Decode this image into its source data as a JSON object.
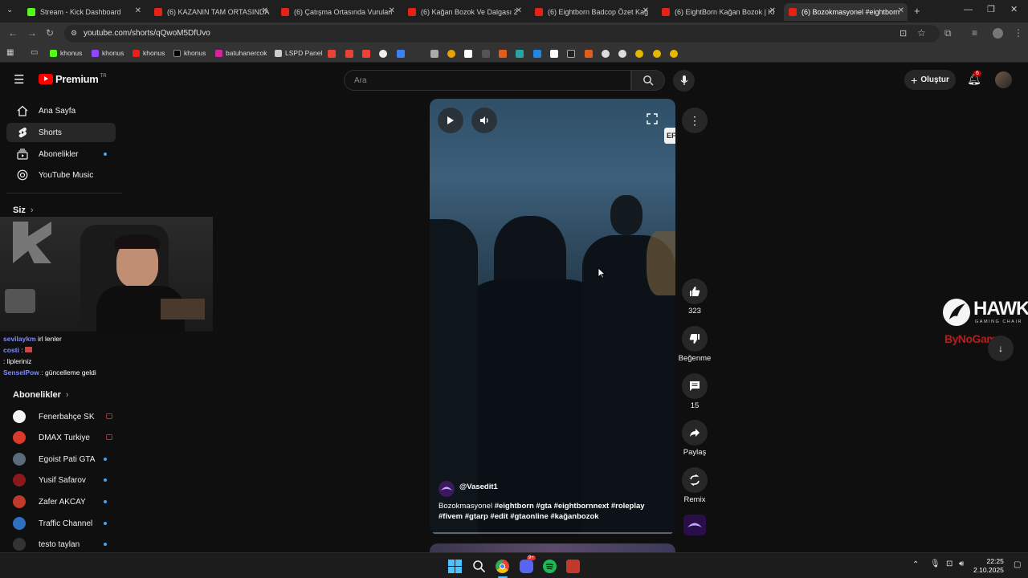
{
  "browser": {
    "tabs": [
      {
        "title": "Stream - Kick Dashboard",
        "icon": "kick"
      },
      {
        "title": "(6) KAZANIN TAM ORTASINDA",
        "icon": "youtube"
      },
      {
        "title": "(6) Çatışma Ortasında Vurulan",
        "icon": "youtube"
      },
      {
        "title": "(6) Kağan Bozok Ve Dalgası 2",
        "icon": "youtube"
      },
      {
        "title": "(6) Eightborn Badcop Özet Kağ",
        "icon": "youtube"
      },
      {
        "title": "(6) EightBorn Kağan Bozok | Ki",
        "icon": "youtube"
      },
      {
        "title": "(6) Bozokmasyonel #eightborn",
        "icon": "youtube",
        "active": true
      }
    ],
    "url": "youtube.com/shorts/qQwoM5DfUvo",
    "bookmarks": [
      "khonus",
      "khonus",
      "khonus",
      "khonus",
      "batuhanercok",
      "LSPD Panel"
    ]
  },
  "youtube": {
    "logo": "Premium",
    "logo_sup": "TR",
    "search_placeholder": "Ara",
    "create_label": "Oluştur",
    "notification_count": "6"
  },
  "sidebar": {
    "items": [
      {
        "label": "Ana Sayfa",
        "icon": "home-icon"
      },
      {
        "label": "Shorts",
        "icon": "shorts-icon",
        "active": true
      },
      {
        "label": "Abonelikler",
        "icon": "subscriptions-icon"
      },
      {
        "label": "YouTube Music",
        "icon": "music-icon"
      }
    ],
    "you_heading": "Siz",
    "subs_heading": "Abonelikler",
    "subscriptions": [
      {
        "name": "Fenerbahçe SK",
        "live": true,
        "color": "#f5f5f5"
      },
      {
        "name": "DMAX Turkiye",
        "live": true,
        "color": "#d93a2a"
      },
      {
        "name": "Egoist Pati GTA",
        "live": false,
        "color": "#5a6b7c"
      },
      {
        "name": "Yusif Safarov",
        "live": false,
        "color": "#8a1a1a"
      },
      {
        "name": "Zafer AKCAY",
        "live": false,
        "color": "#c0392b"
      },
      {
        "name": "Traffic Channel",
        "live": false,
        "color": "#2f6fbf"
      },
      {
        "name": "testo taylan",
        "live": false,
        "color": "#333"
      }
    ]
  },
  "chat": [
    {
      "user": "sevilaykm",
      "text": "irl lenler"
    },
    {
      "user": "costi",
      "text": ":"
    },
    {
      "user": "",
      "text": ": lipleriniz"
    },
    {
      "user": "SenselPow",
      "text": ": güncelleme geldi"
    }
  ],
  "short": {
    "channel": "@Vasedit1",
    "caption_plain": "Bozokmasyonel",
    "caption_tags": "#eightborn #gta #eightbornnext #roleplay #fivem #gtarp #edit #gtaonline #kağanbozok",
    "side_label": "EF",
    "likes": "323",
    "dislike_label": "Beğenme",
    "comments": "15",
    "share_label": "Paylaş",
    "remix_label": "Remix"
  },
  "sponsor": {
    "name": "HAWK",
    "sub": "GAMING CHAIR",
    "secondary": "ByNoGame"
  },
  "taskbar": {
    "time": "22:25",
    "date": "2.10.2025"
  }
}
